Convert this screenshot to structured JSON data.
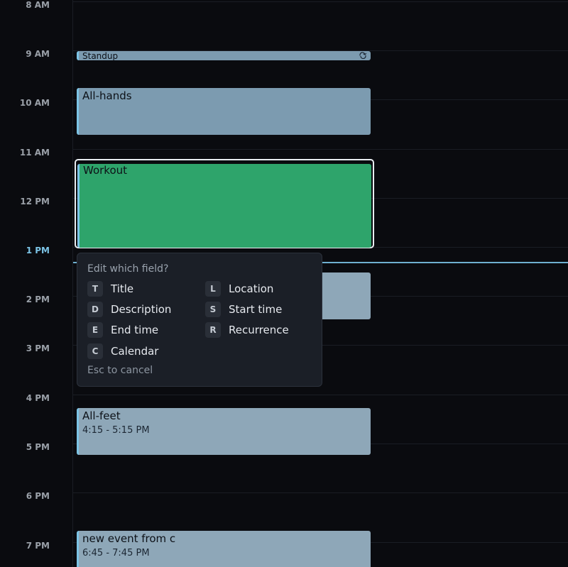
{
  "time_labels": [
    "8 AM",
    "9 AM",
    "10 AM",
    "11 AM",
    "12 PM",
    "1 PM",
    "2 PM",
    "3 PM",
    "4 PM",
    "5 PM",
    "6 PM",
    "7 PM"
  ],
  "current_time_label": "1 PM",
  "events": {
    "standup": {
      "title": "Standup",
      "recurring_icon": "repeat-icon"
    },
    "all_hands": {
      "title": "All-hands"
    },
    "workout": {
      "title": "Workout",
      "selected": true,
      "color": "#2ea46b"
    },
    "all_feet": {
      "title": "All-feet",
      "time": "4:15 - 5:15 PM"
    },
    "new_event": {
      "title": "new event from c",
      "time": "6:45 - 7:45 PM"
    }
  },
  "edit_menu": {
    "title": "Edit which field?",
    "options": [
      {
        "key": "T",
        "label": "Title"
      },
      {
        "key": "L",
        "label": "Location"
      },
      {
        "key": "D",
        "label": "Description"
      },
      {
        "key": "S",
        "label": "Start time"
      },
      {
        "key": "E",
        "label": "End time"
      },
      {
        "key": "R",
        "label": "Recurrence"
      },
      {
        "key": "C",
        "label": "Calendar"
      }
    ],
    "cancel_hint": "Esc to cancel"
  },
  "colors": {
    "background": "#0a0b0f",
    "event_blue": "#7c9bb0",
    "event_accent": "#7cc4e6",
    "event_green": "#2ea46b",
    "now_line": "#6fb0d0",
    "popup_bg": "#1b1f27"
  }
}
